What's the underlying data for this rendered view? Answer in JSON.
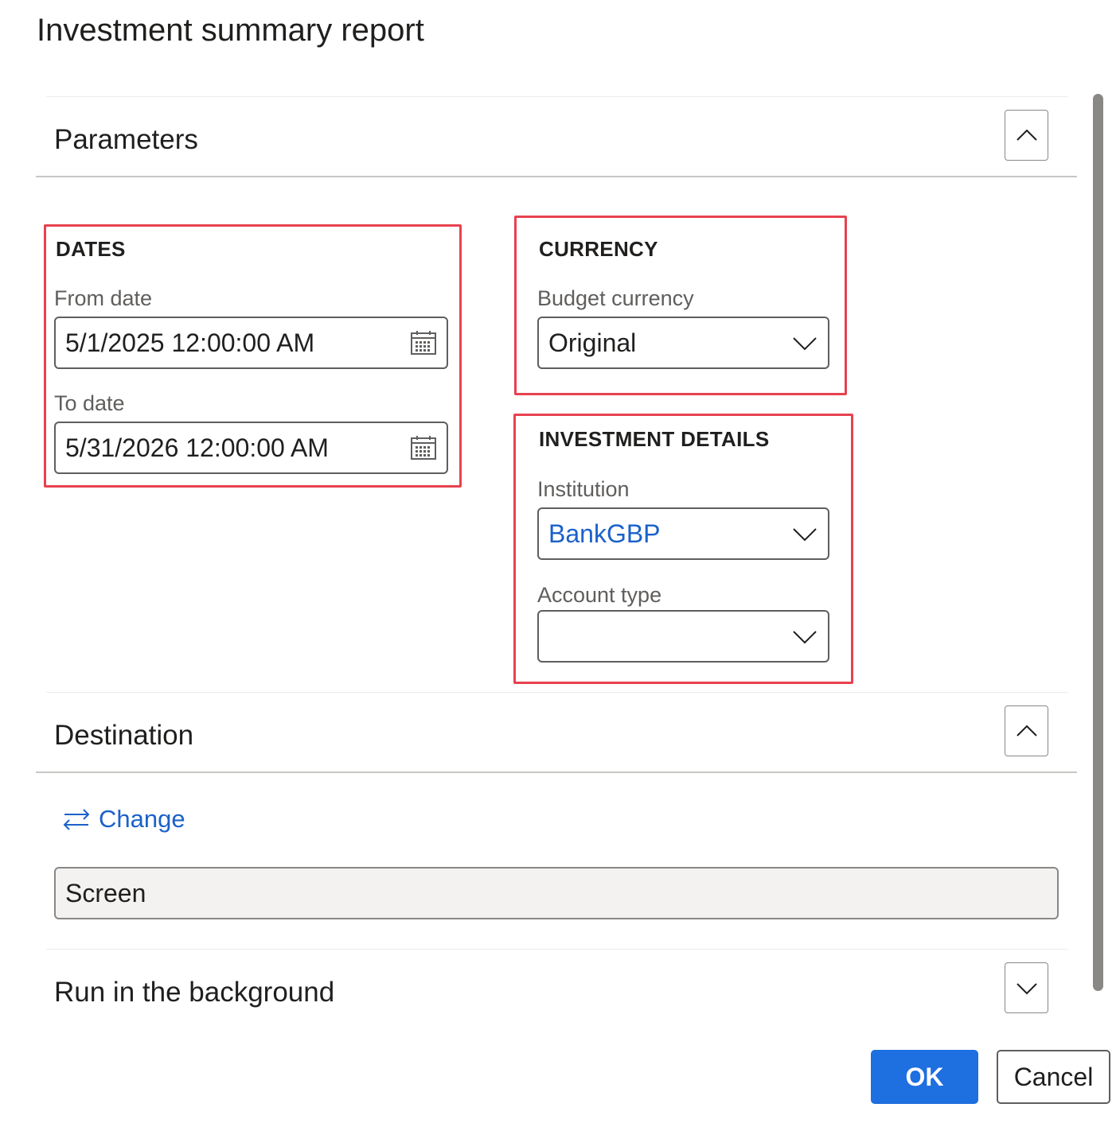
{
  "dialog": {
    "title": "Investment summary report"
  },
  "parameters": {
    "title": "Parameters",
    "dates": {
      "title": "DATES",
      "from_label": "From date",
      "from_value": "5/1/2025 12:00:00 AM",
      "to_label": "To date",
      "to_value": "5/31/2026 12:00:00 AM"
    },
    "currency": {
      "title": "CURRENCY",
      "budget_label": "Budget currency",
      "budget_value": "Original"
    },
    "investment_details": {
      "title": "INVESTMENT DETAILS",
      "institution_label": "Institution",
      "institution_value": "BankGBP",
      "account_type_label": "Account type",
      "account_type_value": ""
    }
  },
  "destination": {
    "title": "Destination",
    "change_label": "Change",
    "value": "Screen"
  },
  "background": {
    "title": "Run in the background"
  },
  "footer": {
    "ok_label": "OK",
    "cancel_label": "Cancel"
  },
  "colors": {
    "accent": "#1e6fe0",
    "link": "#1b61c9",
    "highlight": "#e8414f"
  }
}
